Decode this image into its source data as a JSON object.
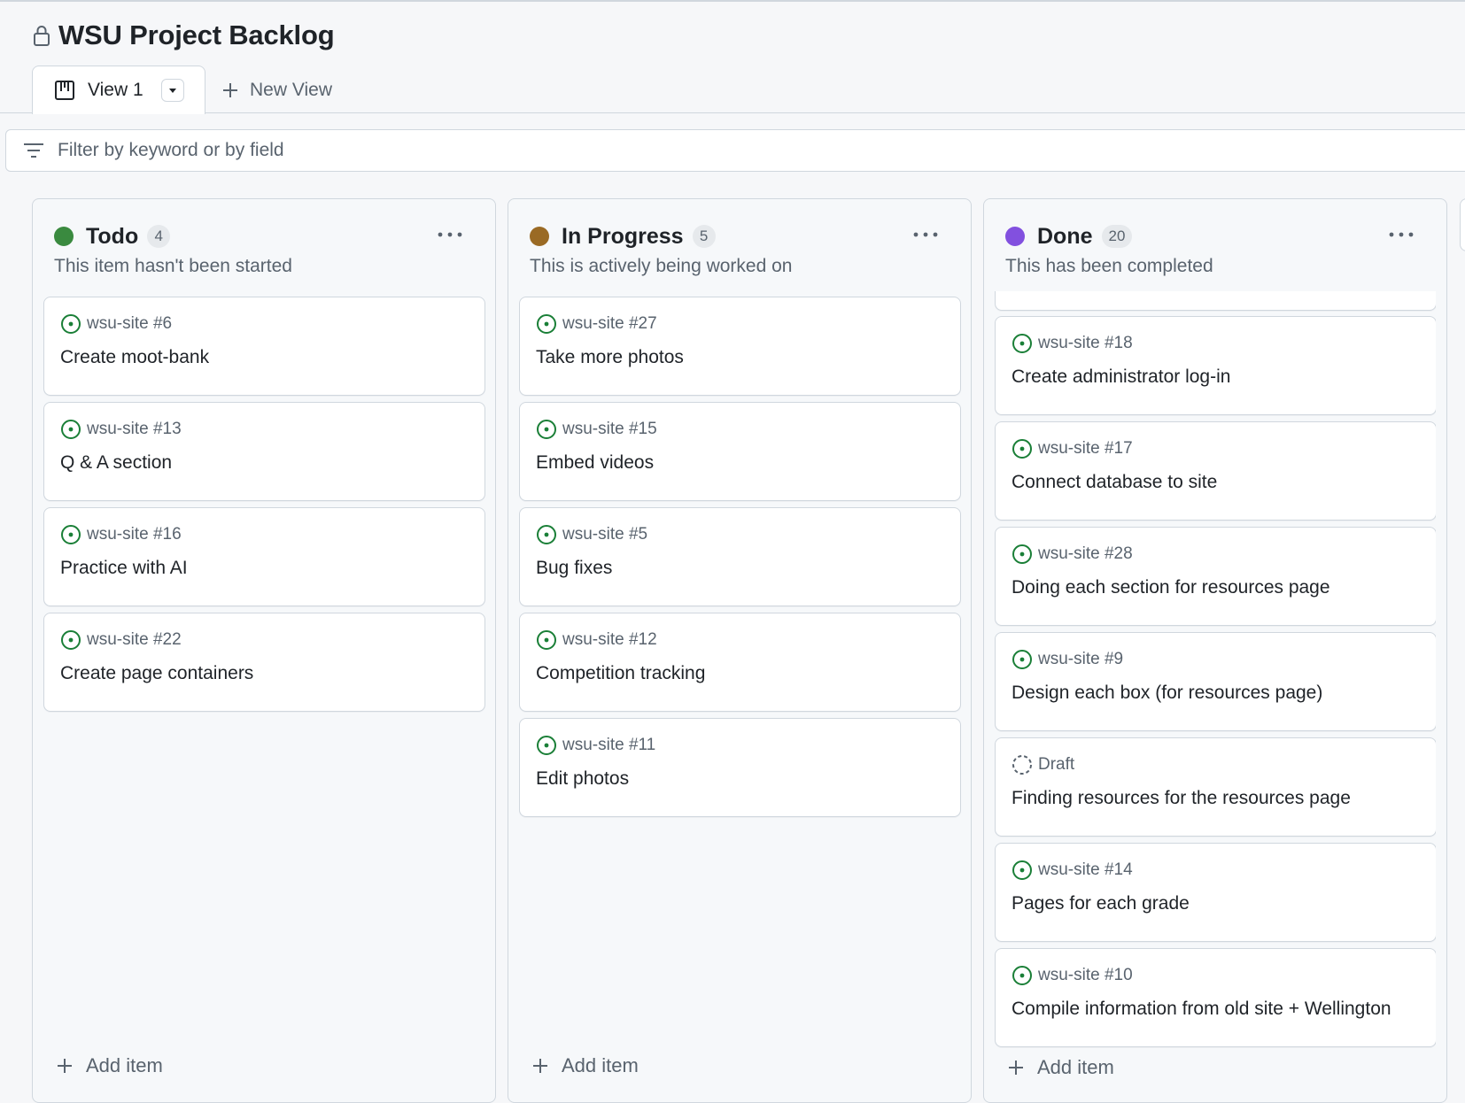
{
  "header": {
    "title": "WSU Project Backlog"
  },
  "tabs": {
    "active_label": "View 1",
    "new_view_label": "New View"
  },
  "filter": {
    "placeholder": "Filter by keyword or by field"
  },
  "colors": {
    "todo": "#3a8a3f",
    "in_progress": "#9a6a24",
    "done": "#8250df",
    "issue_open": "#1a7f37"
  },
  "columns": [
    {
      "name": "Todo",
      "count": "4",
      "description": "This item hasn't been started",
      "add_label": "Add item",
      "cards": [
        {
          "meta": "wsu-site #6",
          "title": "Create moot-bank"
        },
        {
          "meta": "wsu-site #13",
          "title": "Q & A section"
        },
        {
          "meta": "wsu-site #16",
          "title": "Practice with AI"
        },
        {
          "meta": "wsu-site #22",
          "title": "Create page containers"
        }
      ]
    },
    {
      "name": "In Progress",
      "count": "5",
      "description": "This is actively being worked on",
      "add_label": "Add item",
      "cards": [
        {
          "meta": "wsu-site #27",
          "title": "Take more photos"
        },
        {
          "meta": "wsu-site #15",
          "title": "Embed videos"
        },
        {
          "meta": "wsu-site #5",
          "title": "Bug fixes"
        },
        {
          "meta": "wsu-site #12",
          "title": "Competition tracking"
        },
        {
          "meta": "wsu-site #11",
          "title": "Edit photos"
        }
      ]
    },
    {
      "name": "Done",
      "count": "20",
      "description": "This has been completed",
      "add_label": "Add item",
      "cards": [
        {
          "meta": "wsu-site #18",
          "title": "Create administrator log-in"
        },
        {
          "meta": "wsu-site #17",
          "title": "Connect database to site"
        },
        {
          "meta": "wsu-site #28",
          "title": "Doing each section for resources page"
        },
        {
          "meta": "wsu-site #9",
          "title": "Design each box (for resources page)"
        },
        {
          "meta": "Draft",
          "title": "Finding resources for the resources page"
        },
        {
          "meta": "wsu-site #14",
          "title": "Pages for each grade"
        },
        {
          "meta": "wsu-site #10",
          "title": "Compile information from old site + Wellington"
        }
      ]
    }
  ]
}
